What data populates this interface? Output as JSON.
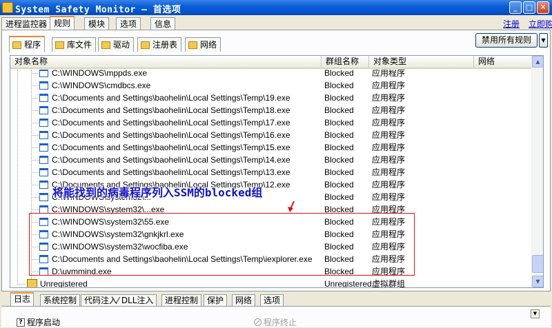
{
  "window": {
    "title": "System Safety Monitor — 首选项",
    "min": "_",
    "max": "□",
    "close": "✕"
  },
  "main_tabs": [
    "进程监控器",
    "规则",
    "模块",
    "选项",
    "信息"
  ],
  "links": {
    "register": "注册",
    "buy": "立即购买"
  },
  "sub_tabs": [
    "程序",
    "库文件",
    "驱动",
    "注册表",
    "网络"
  ],
  "block_all_button": "禁用所有规则",
  "dropdown_arrow": "▼",
  "columns": [
    "对象名称",
    "群组名称",
    "对象类型",
    "网络"
  ],
  "rows": [
    {
      "name": "C:\\WINDOWS\\mppds.exe",
      "group": "Blocked",
      "type": "应用程序"
    },
    {
      "name": "C:\\WINDOWS\\cmdbcs.exe",
      "group": "Blocked",
      "type": "应用程序"
    },
    {
      "name": "C:\\Documents and Settings\\baohelin\\Local Settings\\Temp\\19.exe",
      "group": "Blocked",
      "type": "应用程序"
    },
    {
      "name": "C:\\Documents and Settings\\baohelin\\Local Settings\\Temp\\18.exe",
      "group": "Blocked",
      "type": "应用程序"
    },
    {
      "name": "C:\\Documents and Settings\\baohelin\\Local Settings\\Temp\\17.exe",
      "group": "Blocked",
      "type": "应用程序"
    },
    {
      "name": "C:\\Documents and Settings\\baohelin\\Local Settings\\Temp\\16.exe",
      "group": "Blocked",
      "type": "应用程序"
    },
    {
      "name": "C:\\Documents and Settings\\baohelin\\Local Settings\\Temp\\15.exe",
      "group": "Blocked",
      "type": "应用程序"
    },
    {
      "name": "C:\\Documents and Settings\\baohelin\\Local Settings\\Temp\\14.exe",
      "group": "Blocked",
      "type": "应用程序"
    },
    {
      "name": "C:\\Documents and Settings\\baohelin\\Local Settings\\Temp\\13.exe",
      "group": "Blocked",
      "type": "应用程序"
    },
    {
      "name": "C:\\Documents and Settings\\baohelin\\Local Settings\\Temp\\12.exe",
      "group": "Blocked",
      "type": "应用程序"
    },
    {
      "name": "C:\\WINDOWS\\system32\\...",
      "group": "Blocked",
      "type": "应用程序"
    },
    {
      "name": "C:\\WINDOWS\\system32\\...exe",
      "group": "Blocked",
      "type": "应用程序"
    },
    {
      "name": "C:\\WINDOWS\\system32\\55.exe",
      "group": "Blocked",
      "type": "应用程序"
    },
    {
      "name": "C:\\WINDOWS\\system32\\gnkjkrl.exe",
      "group": "Blocked",
      "type": "应用程序"
    },
    {
      "name": "C:\\WINDOWS\\system32\\wocfiba.exe",
      "group": "Blocked",
      "type": "应用程序"
    },
    {
      "name": "C:\\Documents and Settings\\baohelin\\Local Settings\\Temp\\iexplorer.exe",
      "group": "Blocked",
      "type": "应用程序"
    },
    {
      "name": "D:\\uvmmind.exe",
      "group": "Blocked",
      "type": "应用程序"
    }
  ],
  "unregistered_row": {
    "name": "Unregistered",
    "group": "Unregistered",
    "type": "虚拟群组"
  },
  "annotation": "将能找到的病毒程序列入SSM的blocked组",
  "scroll": {
    "up": "▲",
    "down": "▼"
  },
  "bottom_tabs": [
    "日志",
    "系统控制",
    "代码注入⁄ DLL注入",
    "进程控制",
    "保护",
    "网络",
    "选项"
  ],
  "bottom_actions": {
    "start": "程序启动",
    "terminate": "程序终止",
    "help_icon": "?"
  },
  "colors": {
    "titlebar": "#0a5fd8",
    "annotation": "#1010c8",
    "highlight_box": "#e01010",
    "active_tab_accent": "#e68b2c"
  }
}
